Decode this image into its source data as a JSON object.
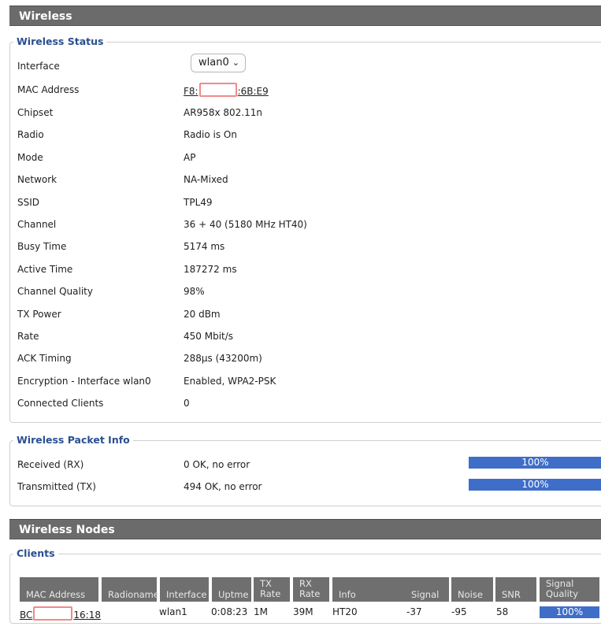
{
  "wireless_header": "Wireless",
  "status": {
    "legend": "Wireless Status",
    "interface_label": "Interface",
    "interface_value": "wlan0",
    "mac_label": "MAC Address",
    "mac_prefix": "F8:",
    "mac_suffix": ":6B:E9",
    "rows": [
      {
        "label": "Chipset",
        "value": "AR958x 802.11n"
      },
      {
        "label": "Radio",
        "value": "Radio is On"
      },
      {
        "label": "Mode",
        "value": "AP"
      },
      {
        "label": "Network",
        "value": "NA-Mixed"
      },
      {
        "label": "SSID",
        "value": "TPL49"
      },
      {
        "label": "Channel",
        "value": "36 + 40 (5180 MHz HT40)"
      },
      {
        "label": "Busy Time",
        "value": "5174 ms"
      },
      {
        "label": "Active Time",
        "value": "187272 ms"
      },
      {
        "label": "Channel Quality",
        "value": "98%"
      },
      {
        "label": "TX Power",
        "value": "20 dBm"
      },
      {
        "label": "Rate",
        "value": "450 Mbit/s"
      },
      {
        "label": "ACK Timing",
        "value": "288µs (43200m)"
      },
      {
        "label": "Encryption - Interface wlan0",
        "value": "Enabled, WPA2-PSK"
      },
      {
        "label": "Connected Clients",
        "value": "0"
      }
    ]
  },
  "packet": {
    "legend": "Wireless Packet Info",
    "rx_label": "Received (RX)",
    "rx_value": "0 OK, no error",
    "rx_percent": "100%",
    "tx_label": "Transmitted (TX)",
    "tx_value": "494 OK, no error",
    "tx_percent": "100%"
  },
  "nodes_header": "Wireless Nodes",
  "clients": {
    "legend": "Clients",
    "headers": {
      "mac": "MAC Address",
      "radioname": "Radioname",
      "interface": "Interface",
      "uptime": "Uptme",
      "tx_rate_1": "TX",
      "tx_rate_2": "Rate",
      "rx_rate_1": "RX",
      "rx_rate_2": "Rate",
      "info": "Info",
      "signal": "Signal",
      "noise": "Noise",
      "snr": "SNR",
      "quality_1": "Signal",
      "quality_2": "Quality"
    },
    "row": {
      "mac_prefix": "BC",
      "mac_suffix": "16:18",
      "radioname": "",
      "interface": "wlan1",
      "uptime": "0:08:23",
      "tx_rate": "1M",
      "rx_rate": "39M",
      "info": "HT20",
      "signal": "-37",
      "noise": "-95",
      "snr": "58",
      "quality": "100%"
    }
  },
  "colors": {
    "header_bg": "#6b6b6b",
    "legend_text": "#2a4f8f",
    "bar_fill": "#3f6ec9",
    "redaction_box": "#f08a8a"
  }
}
